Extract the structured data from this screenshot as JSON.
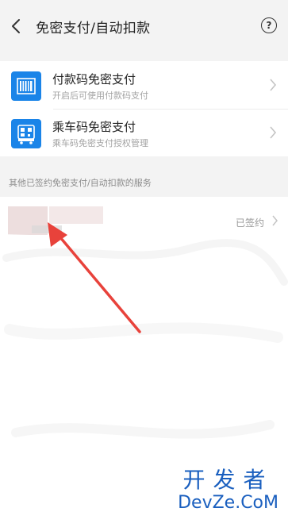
{
  "header": {
    "back_icon": "chevron-left-icon",
    "title": "免密支付/自动扣款",
    "help_icon": "question-circle-icon",
    "help_glyph": "?"
  },
  "rows": [
    {
      "title": "付款码免密支付",
      "subtitle": "开启后可使用付款码支付",
      "icon": "barcode-icon",
      "color": "#1a84e8"
    },
    {
      "title": "乘车码免密支付",
      "subtitle": "乘车码免密支付授权管理",
      "icon": "bus-qrcode-icon",
      "color": "#1a84e8"
    }
  ],
  "section": {
    "label": "其他已签约免密支付/自动扣款的服务"
  },
  "service": {
    "status": "已签约"
  },
  "annotation": {
    "color": "#e8423b"
  },
  "watermark": {
    "line1": "开发者",
    "line2": "DevZe.CoM",
    "color": "#1a5fbf"
  }
}
